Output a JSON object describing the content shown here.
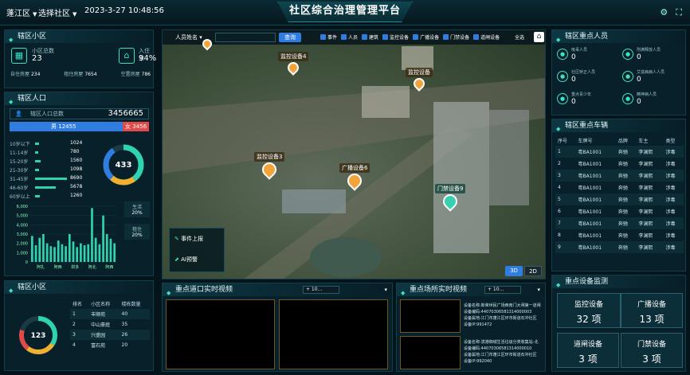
{
  "header": {
    "district": "蓬江区",
    "community": "选择社区",
    "datetime": "2023-3-27 10:48:56",
    "title": "社区综合治理管理平台"
  },
  "community_panel": {
    "title": "辖区小区",
    "count_label": "小区总数",
    "count": "23",
    "occupancy_label": "入住率",
    "occupancy": "94%",
    "types": [
      {
        "label": "自住房屋",
        "value": "234"
      },
      {
        "label": "租住房屋",
        "value": "7654"
      },
      {
        "label": "空置房屋",
        "value": "786"
      }
    ]
  },
  "population_panel": {
    "title": "辖区人口",
    "total_label": "辖区人口总数",
    "total": "3456665",
    "male_label": "男",
    "male": "12455",
    "female_label": "女",
    "female": "3456",
    "ages": [
      {
        "label": "10岁以下",
        "value": "1024",
        "pct": 0.12
      },
      {
        "label": "11-14岁",
        "value": "780",
        "pct": 0.09
      },
      {
        "label": "15-20岁",
        "value": "1560",
        "pct": 0.18
      },
      {
        "label": "21-30岁",
        "value": "1098",
        "pct": 0.13
      },
      {
        "label": "31-45岁",
        "value": "8690",
        "pct": 1.0
      },
      {
        "label": "46-60岁",
        "value": "5678",
        "pct": 0.65
      },
      {
        "label": "60岁以上",
        "value": "1260",
        "pct": 0.15
      }
    ],
    "ring_value": "433",
    "tag1_name": "生活",
    "tag1_val": "20%",
    "tag2_name": "租住",
    "tag2_val": "20%"
  },
  "chart_data": {
    "type": "bar",
    "categories": [
      "",
      "",
      "",
      "",
      "",
      "",
      "",
      "",
      "",
      "",
      "",
      "",
      "",
      "",
      "",
      "",
      "",
      "",
      "",
      "",
      "",
      "",
      ""
    ],
    "xticks": [
      "阿扎",
      "阿西",
      "拼多",
      "阿北",
      "阿西"
    ],
    "values": [
      2800,
      1800,
      2600,
      3000,
      2000,
      1700,
      1600,
      2300,
      1900,
      1700,
      3000,
      2200,
      1600,
      2000,
      1800,
      1900,
      5800,
      2600,
      1900,
      5000,
      3000,
      2500,
      2000
    ],
    "yticks": [
      "6,000",
      "5,000",
      "4,000",
      "3,000",
      "2,000",
      "1,000",
      "0"
    ],
    "ylim": [
      0,
      6000
    ]
  },
  "ranking_panel": {
    "title": "辖区小区",
    "ring": "123",
    "headers": [
      "排名",
      "小区名称",
      "楼栋数量"
    ],
    "rows": [
      [
        "1",
        "丰顺苑",
        "40"
      ],
      [
        "2",
        "中山豪庭",
        "35"
      ],
      [
        "3",
        "兴盛园",
        "26"
      ],
      [
        "4",
        "富石苑",
        "20"
      ]
    ]
  },
  "map": {
    "search_label": "人员姓名",
    "search_btn": "查询",
    "all": "全选",
    "filters": [
      "事件",
      "人员",
      "建筑",
      "监控设备",
      "广播设备",
      "门禁设备",
      "道闸设备"
    ],
    "pins": [
      {
        "label": "监控设备4",
        "color": "#f2a33a"
      },
      {
        "label": "监控设备",
        "color": "#f2a33a"
      },
      {
        "label": "监控设备3",
        "color": "#f2a33a"
      },
      {
        "label": "广播设备6",
        "color": "#f2a33a"
      },
      {
        "label": "门禁设备9",
        "color": "#37d0b0"
      }
    ],
    "btn_report": "事件上报",
    "btn_ai": "AI预警",
    "mode3d": "3D",
    "mode2d": "2D"
  },
  "video1": {
    "title": "重点道口实时视频",
    "sel": "+ 10..."
  },
  "video2": {
    "title": "重点场所实时视频",
    "sel": "+ 10...",
    "info1": [
      "设备名称:新荣世民广场西南门大闸第一道闸",
      "设备编码:44070306581314000003",
      "设备属地:江门市蓬江区环市街道石冲社区",
      "设备IP:991472"
    ],
    "info2": [
      "设备名称:滨港御城生活垃圾分类收集站-北",
      "设备编码:44070306581314000010",
      "设备属地:江门市蓬江区环市街道石冲社区",
      "设备IP:992040"
    ]
  },
  "persons_panel": {
    "title": "辖区重点人员",
    "items": [
      {
        "label": "吸毒人员",
        "value": "0"
      },
      {
        "label": "刑满释放人员",
        "value": "0"
      },
      {
        "label": "社区矫正人员",
        "value": "0"
      },
      {
        "label": "艾滋病病人人员",
        "value": "0"
      },
      {
        "label": "重点青少年",
        "value": "0"
      },
      {
        "label": "精神病人员",
        "value": "0"
      }
    ]
  },
  "vehicles_panel": {
    "title": "辖区重点车辆",
    "headers": [
      "序号",
      "车牌号",
      "品牌",
      "车主",
      "类型"
    ],
    "rows": [
      [
        "1",
        "粤BA1001",
        "奔驰",
        "李澜熙",
        "涉毒"
      ],
      [
        "2",
        "粤BA1001",
        "奔驰",
        "李澜熙",
        "涉毒"
      ],
      [
        "3",
        "粤BA1001",
        "奔驰",
        "李澜熙",
        "涉毒"
      ],
      [
        "4",
        "粤BA1001",
        "奔驰",
        "李澜熙",
        "涉毒"
      ],
      [
        "5",
        "粤BA1001",
        "奔驰",
        "李澜熙",
        "涉毒"
      ],
      [
        "6",
        "粤BA1001",
        "奔驰",
        "李澜熙",
        "涉毒"
      ],
      [
        "7",
        "粤BA1001",
        "奔驰",
        "李澜熙",
        "涉毒"
      ],
      [
        "8",
        "粤BA1001",
        "奔驰",
        "李澜熙",
        "涉毒"
      ],
      [
        "9",
        "粤BA1001",
        "奔驰",
        "李澜熙",
        "涉毒"
      ]
    ]
  },
  "devices_panel": {
    "title": "重点设备监测",
    "items": [
      {
        "name": "监控设备",
        "count": "32 项"
      },
      {
        "name": "广播设备",
        "count": "13 项"
      },
      {
        "name": "道闸设备",
        "count": "3 项"
      },
      {
        "name": "门禁设备",
        "count": "3 项"
      }
    ]
  }
}
